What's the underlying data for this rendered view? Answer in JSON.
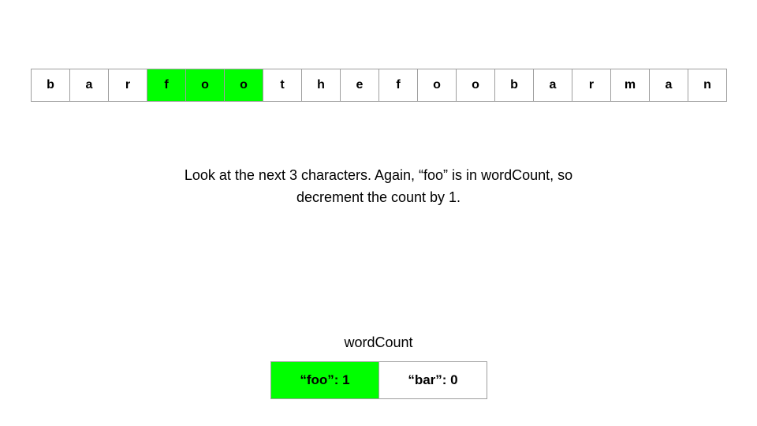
{
  "highlight_color": "#00ff00",
  "string_cells": [
    {
      "char": "b",
      "highlighted": false
    },
    {
      "char": "a",
      "highlighted": false
    },
    {
      "char": "r",
      "highlighted": false
    },
    {
      "char": "f",
      "highlighted": true
    },
    {
      "char": "o",
      "highlighted": true
    },
    {
      "char": "o",
      "highlighted": true
    },
    {
      "char": "t",
      "highlighted": false
    },
    {
      "char": "h",
      "highlighted": false
    },
    {
      "char": "e",
      "highlighted": false
    },
    {
      "char": "f",
      "highlighted": false
    },
    {
      "char": "o",
      "highlighted": false
    },
    {
      "char": "o",
      "highlighted": false
    },
    {
      "char": "b",
      "highlighted": false
    },
    {
      "char": "a",
      "highlighted": false
    },
    {
      "char": "r",
      "highlighted": false
    },
    {
      "char": "m",
      "highlighted": false
    },
    {
      "char": "a",
      "highlighted": false
    },
    {
      "char": "n",
      "highlighted": false
    }
  ],
  "caption": {
    "line1": "Look at the next 3 characters. Again, “foo” is in wordCount, so",
    "line2": "decrement the count by 1."
  },
  "word_count": {
    "title": "wordCount",
    "entries": [
      {
        "label": "“foo”: 1",
        "highlighted": true
      },
      {
        "label": "“bar”: 0",
        "highlighted": false
      }
    ]
  }
}
